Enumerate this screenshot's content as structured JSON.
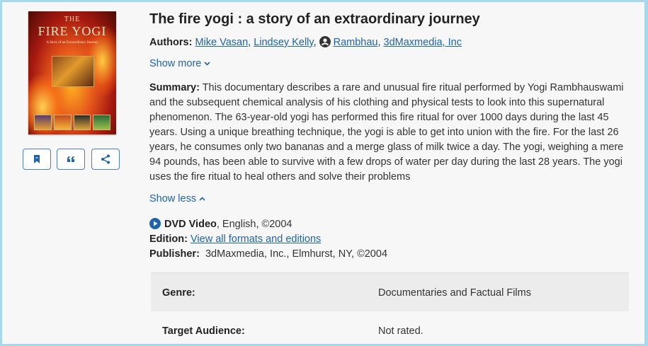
{
  "cover": {
    "title_top": "THE",
    "title": "FIRE YOGI",
    "subtitle": "A Story of an Extraordinary Journey"
  },
  "actions": [
    {
      "name": "save",
      "icon": "bookmark-icon"
    },
    {
      "name": "cite",
      "icon": "quote-icon"
    },
    {
      "name": "share",
      "icon": "share-icon"
    }
  ],
  "title": "The fire yogi : a story of an extraordinary journey",
  "authors": {
    "label": "Authors:",
    "items": [
      "Mike Vasan",
      "Lindsey Kelly",
      "Rambhau",
      "3dMaxmedia, Inc"
    ]
  },
  "show_more": "Show more",
  "summary": {
    "label": "Summary:",
    "text": "This documentary describes a rare and unusual fire ritual performed by Yogi Rambhauswami and the subsequent chemical analysis of his clothing and physical tests to look into this supernatural phenomenon. The 63-year-old yogi has performed this fire ritual for over 1000 days during the last 45 years. Using a unique breathing technique, the yogi is able to get into union with the fire. For the last 26 years, he consumes only two bananas and a merge glass of milk twice a day. The yogi, weighing a mere 94 pounds, has been able to survive with a few drops of water per day during the last 28 years. The yogi uses the fire ritual to heal others and solve their problems"
  },
  "show_less": "Show less",
  "format": {
    "type": "DVD Video",
    "rest": ", English, ©2004"
  },
  "edition": {
    "label": "Edition:",
    "link": "View all formats and editions"
  },
  "publisher": {
    "label": "Publisher:",
    "value": "3dMaxmedia, Inc., Elmhurst, NY, ©2004"
  },
  "details": [
    {
      "key": "Genre:",
      "value": "Documentaries and Factual Films"
    },
    {
      "key": "Target Audience:",
      "value": "Not rated."
    }
  ],
  "colors": {
    "link": "#1f63a8",
    "border": "#a9d8ea",
    "button_border": "#4a7fc0"
  }
}
